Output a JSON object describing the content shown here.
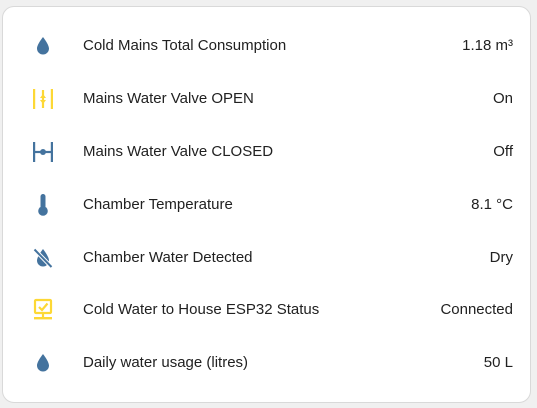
{
  "colors": {
    "icon_blue": "#44739e",
    "icon_yellow": "#fdd835",
    "text": "#212121",
    "card_bg": "#ffffff"
  },
  "entities": [
    {
      "name": "Cold Mains Total Consumption",
      "state": "1.18 m³",
      "icon": "water-drop-icon"
    },
    {
      "name": "Mains Water Valve OPEN",
      "state": "On",
      "icon": "valve-open-icon"
    },
    {
      "name": "Mains Water Valve CLOSED",
      "state": "Off",
      "icon": "valve-closed-icon"
    },
    {
      "name": "Chamber Temperature",
      "state": "8.1 °C",
      "icon": "thermometer-icon"
    },
    {
      "name": "Chamber Water Detected",
      "state": "Dry",
      "icon": "water-off-icon"
    },
    {
      "name": "Cold Water to House ESP32 Status",
      "state": "Connected",
      "icon": "lan-connect-icon"
    },
    {
      "name": "Daily water usage (litres)",
      "state": "50 L",
      "icon": "water-drop-icon"
    }
  ]
}
